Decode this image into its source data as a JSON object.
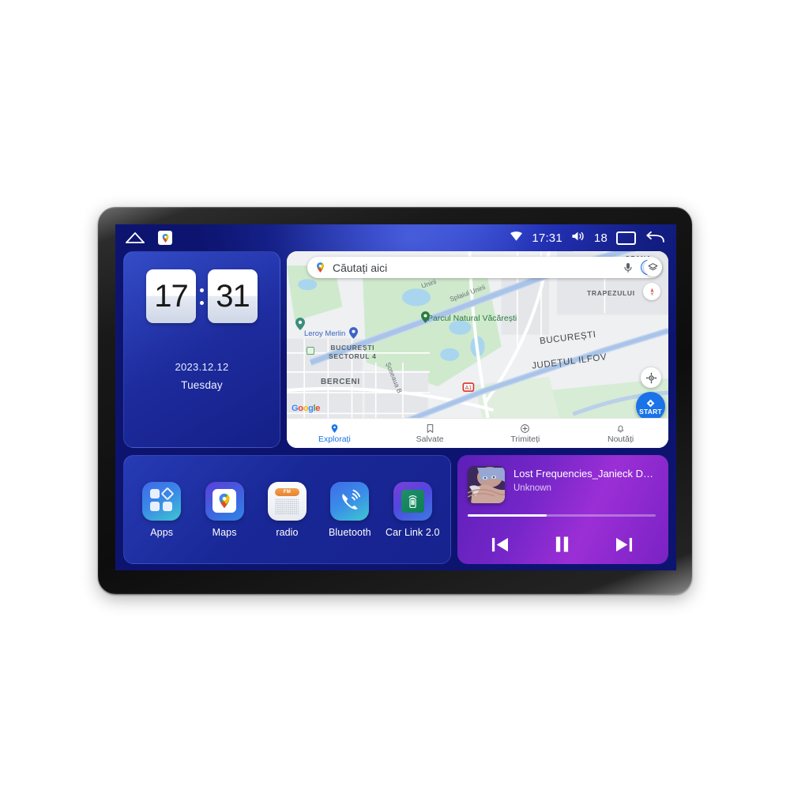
{
  "statusbar": {
    "home_icon": "home-icon",
    "maps_icon": "google-maps-icon",
    "wifi_icon": "wifi-icon",
    "time": "17:31",
    "volume_icon": "volume-icon",
    "volume_level": "18",
    "recents_icon": "recents-icon",
    "back_icon": "back-icon"
  },
  "clock_widget": {
    "hours": "17",
    "minutes": "31",
    "date": "2023.12.12",
    "weekday": "Tuesday"
  },
  "map": {
    "search_placeholder": "Căutați aici",
    "mic_icon": "microphone-icon",
    "avatar_icon": "account-avatar-icon",
    "layers_icon": "map-layers-icon",
    "compass_icon": "compass-icon",
    "locate_icon": "my-location-icon",
    "start_label": "START",
    "brand": "Google",
    "labels": [
      {
        "text": "Splaiul Unirii",
        "kind": "road"
      },
      {
        "text": "Unirii",
        "kind": "road"
      },
      {
        "text": "Parcul Natural Văcărești",
        "kind": "park"
      },
      {
        "text": "Leroy Merlin",
        "kind": "poi"
      },
      {
        "text": "BUCUREȘTI",
        "kind": "city"
      },
      {
        "text": "JUDEȚUL ILFOV",
        "kind": "city"
      },
      {
        "text": "BUCUREȘTI SECTORUL 4",
        "kind": "area"
      },
      {
        "text": "BERCENI",
        "kind": "area"
      },
      {
        "text": "TRAPEZULUI",
        "kind": "area"
      },
      {
        "text": "OZANA",
        "kind": "area"
      },
      {
        "text": "Șoseaua B",
        "kind": "road"
      }
    ],
    "tabs": [
      {
        "label": "Explorați",
        "icon": "explore-pin-icon",
        "active": true
      },
      {
        "label": "Salvate",
        "icon": "bookmark-icon",
        "active": false
      },
      {
        "label": "Trimiteți",
        "icon": "send-to-icon",
        "active": false
      },
      {
        "label": "Noutăți",
        "icon": "bell-icon",
        "active": false
      }
    ]
  },
  "dock": {
    "apps": [
      {
        "label": "Apps",
        "icon": "apps-grid-icon"
      },
      {
        "label": "Maps",
        "icon": "google-maps-icon"
      },
      {
        "label": "radio",
        "icon": "fm-radio-icon",
        "badge": "FM"
      },
      {
        "label": "Bluetooth",
        "icon": "bluetooth-phone-icon"
      },
      {
        "label": "Car Link 2.0",
        "icon": "car-link-icon"
      }
    ]
  },
  "music": {
    "title": "Lost Frequencies_Janieck Devy-...",
    "artist": "Unknown",
    "progress_percent": 42,
    "prev_icon": "previous-track-icon",
    "play_pause_icon": "pause-icon",
    "next_icon": "next-track-icon",
    "album_art": "album-art"
  },
  "colors": {
    "accent_blue": "#1a73e8",
    "screen_blue": "#1a2aa8",
    "music_purple": "#9b2fd6",
    "fm_orange": "#e8822f"
  }
}
